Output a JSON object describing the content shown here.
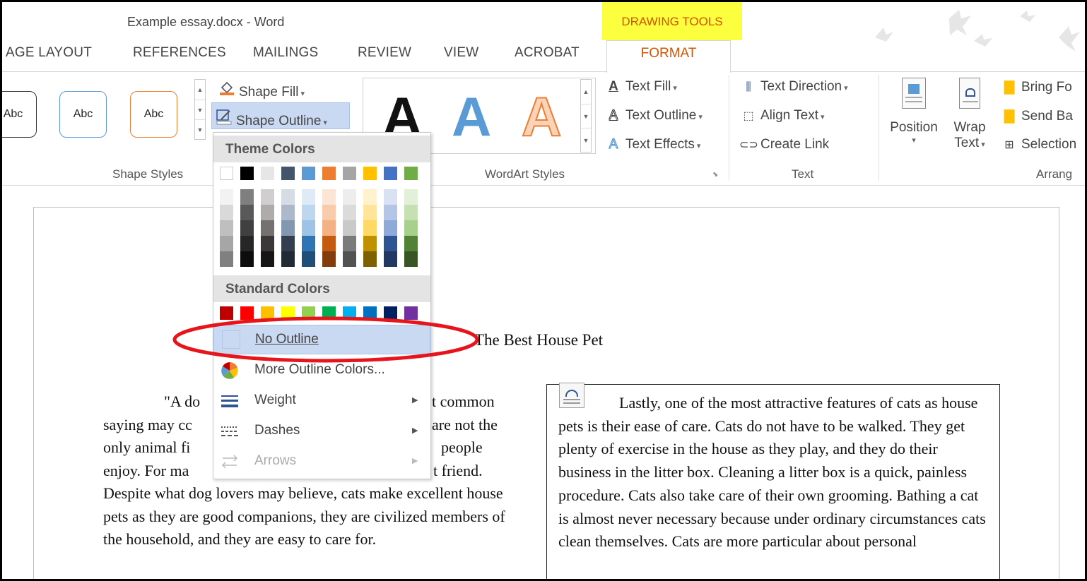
{
  "window": {
    "title": "Example essay.docx - Word",
    "context_tab": "DRAWING TOOLS"
  },
  "tabs": [
    "AGE LAYOUT",
    "REFERENCES",
    "MAILINGS",
    "REVIEW",
    "VIEW",
    "ACROBAT"
  ],
  "active_tab": "FORMAT",
  "ribbon": {
    "shape_styles": {
      "samples": [
        "Abc",
        "Abc",
        "Abc"
      ],
      "shape_fill": "Shape Fill",
      "shape_outline": "Shape Outline",
      "label": "Shape Styles"
    },
    "wordart_styles": {
      "letters": [
        "A",
        "A",
        "A"
      ],
      "label": "WordArt Styles"
    },
    "wordart_commands": {
      "text_fill": "Text Fill",
      "text_outline": "Text Outline",
      "text_effects": "Text Effects"
    },
    "text_group": {
      "text_direction": "Text Direction",
      "align_text": "Align Text",
      "create_link": "Create Link",
      "label": "Text"
    },
    "arrange": {
      "position": "Position",
      "wrap_text_line1": "Wrap",
      "wrap_text_line2": "Text",
      "bring_forward": "Bring Fo",
      "send_backward": "Send Ba",
      "selection": "Selection",
      "label": "Arrang"
    }
  },
  "menu": {
    "theme_colors_header": "Theme Colors",
    "theme_colors": [
      [
        "#ffffff",
        "#f2f2f2",
        "#d9d9d9",
        "#bfbfbf",
        "#a6a6a6",
        "#808080"
      ],
      [
        "#000000",
        "#7f7f7f",
        "#595959",
        "#404040",
        "#262626",
        "#0d0d0d"
      ],
      [
        "#e7e6e6",
        "#d0cece",
        "#aeabab",
        "#757171",
        "#3a3838",
        "#171616"
      ],
      [
        "#44546a",
        "#d6dce4",
        "#adb9ca",
        "#8497b0",
        "#333f4f",
        "#222a35"
      ],
      [
        "#5b9bd5",
        "#deebf6",
        "#bdd7ee",
        "#9dc3e6",
        "#2e75b5",
        "#1f4e79"
      ],
      [
        "#ed7d31",
        "#fbe5d5",
        "#f7cbac",
        "#f4b183",
        "#c55a11",
        "#833c0b"
      ],
      [
        "#a5a5a5",
        "#ededed",
        "#dbdbdb",
        "#c9c9c9",
        "#7b7b7b",
        "#525252"
      ],
      [
        "#ffc000",
        "#fff2cc",
        "#fee599",
        "#ffd965",
        "#bf9000",
        "#7f6000"
      ],
      [
        "#4472c4",
        "#d9e2f3",
        "#b4c6e7",
        "#8eaadb",
        "#2f5496",
        "#1f3864"
      ],
      [
        "#70ad47",
        "#e2efd9",
        "#c5e0b3",
        "#a8d08d",
        "#538135",
        "#375623"
      ]
    ],
    "standard_colors_header": "Standard Colors",
    "standard_colors": [
      "#c00000",
      "#ff0000",
      "#ffc000",
      "#ffff00",
      "#92d050",
      "#00b050",
      "#00b0f0",
      "#0070c0",
      "#002060",
      "#7030a0"
    ],
    "no_outline": "No Outline",
    "more_outline_colors": "More Outline Colors...",
    "weight": "Weight",
    "dashes": "Dashes",
    "arrows": "Arrows"
  },
  "document": {
    "title": "The Best House Pet",
    "left_column": {
      "line1": "\"A do",
      "line1_end": "t common",
      "line2": "saying may cc",
      "line2_end": "are not the",
      "line3": "only animal fi",
      "line3_end": "people",
      "line4": "enjoy. For ma",
      "line4_end": "t friend.",
      "rest": "Despite what dog lovers may believe, cats make excellent house pets as they are good companions, they are civilized members of the household, and they are easy to care for."
    },
    "right_textbox": "Lastly, one of the most attractive features of cats as house pets is their ease of care. Cats do not have to be walked. They get plenty of exercise in the house as they play, and they do their business in the litter box. Cleaning a litter box is a quick, painless procedure. Cats also take care of their own grooming. Bathing a cat is almost never necessary because under ordinary circumstances cats clean themselves. Cats are more particular about personal"
  },
  "colors": {
    "accent": "#d35400",
    "highlight": "#fbff3d",
    "selection": "#c9d9f1",
    "annotation": "#e8141b"
  }
}
